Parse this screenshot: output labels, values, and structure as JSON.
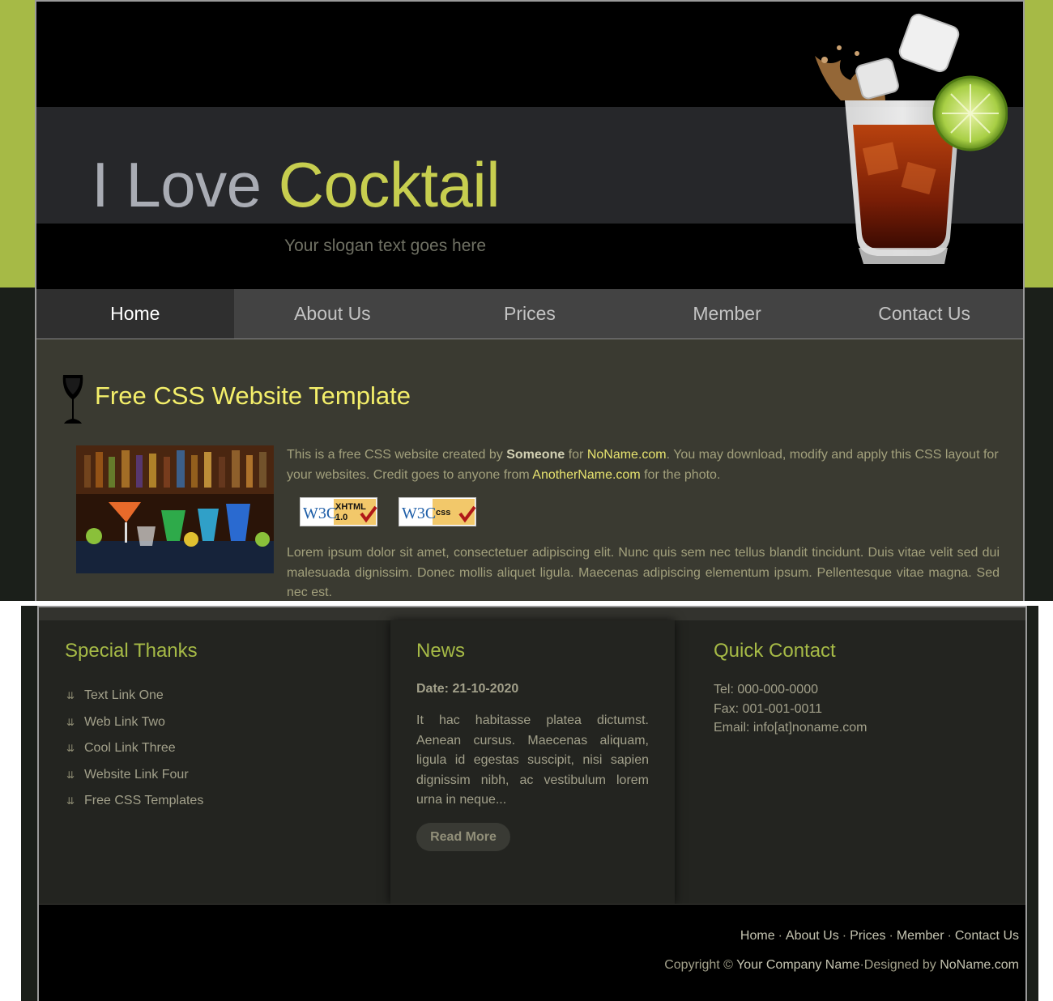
{
  "header": {
    "title_part1": "I Love",
    "title_part2": "Cocktail",
    "slogan": "Your slogan text goes here"
  },
  "nav": {
    "items": [
      "Home",
      "About Us",
      "Prices",
      "Member",
      "Contact Us"
    ],
    "active": "Home"
  },
  "main": {
    "heading": "Free CSS Website Template",
    "intro": {
      "t1": "This is a free CSS website created by ",
      "author": "Someone",
      "t2": " for ",
      "link1": "NoName.com",
      "t3": ". You may download, modify and apply this CSS layout for your websites. Credit goes to anyone from ",
      "link2": "AnotherName.com",
      "t4": " for the photo."
    },
    "badges": [
      {
        "logo": "W3C",
        "label_line1": "XHTML",
        "label_line2": "1.0"
      },
      {
        "logo": "W3C",
        "label_line1": "css",
        "label_line2": ""
      }
    ],
    "lorem": "Lorem ipsum dolor sit amet, consectetuer adipiscing elit. Nunc quis sem nec tellus blandit tincidunt. Duis vitae velit sed dui malesuada dignissim. Donec mollis aliquet ligula. Maecenas adipiscing elementum ipsum. Pellentesque vitae magna. Sed nec est."
  },
  "footer": {
    "special_thanks": {
      "title": "Special Thanks",
      "links": [
        "Text Link One",
        "Web Link Two",
        "Cool Link Three",
        "Website Link Four",
        "Free CSS Templates"
      ]
    },
    "news": {
      "title": "News",
      "date": "Date: 21-10-2020",
      "text": "It hac habitasse platea dictumst. Aenean cursus. Maecenas aliquam, ligula id egestas suscipit, nisi sapien dignissim nibh, ac vestibulum lorem urna in neque...",
      "button": "Read More"
    },
    "quick_contact": {
      "title": "Quick Contact",
      "tel": "Tel: 000-000-0000",
      "fax": "Fax: 001-001-0011",
      "email": "Email: info[at]noname.com"
    },
    "bottom_nav": [
      "Home",
      "About Us",
      "Prices",
      "Member",
      "Contact Us"
    ],
    "separator": "·",
    "copyright_prefix": "Copyright © ",
    "company": "Your Company Name",
    "designed_prefix": "Designed by ",
    "designer": "NoName.com"
  },
  "colors": {
    "accent_green": "#a6ba46",
    "title_yellow": "#c7ce4f",
    "heading_yellow": "#f4ef6a",
    "link_yellow": "#e7e36f"
  }
}
